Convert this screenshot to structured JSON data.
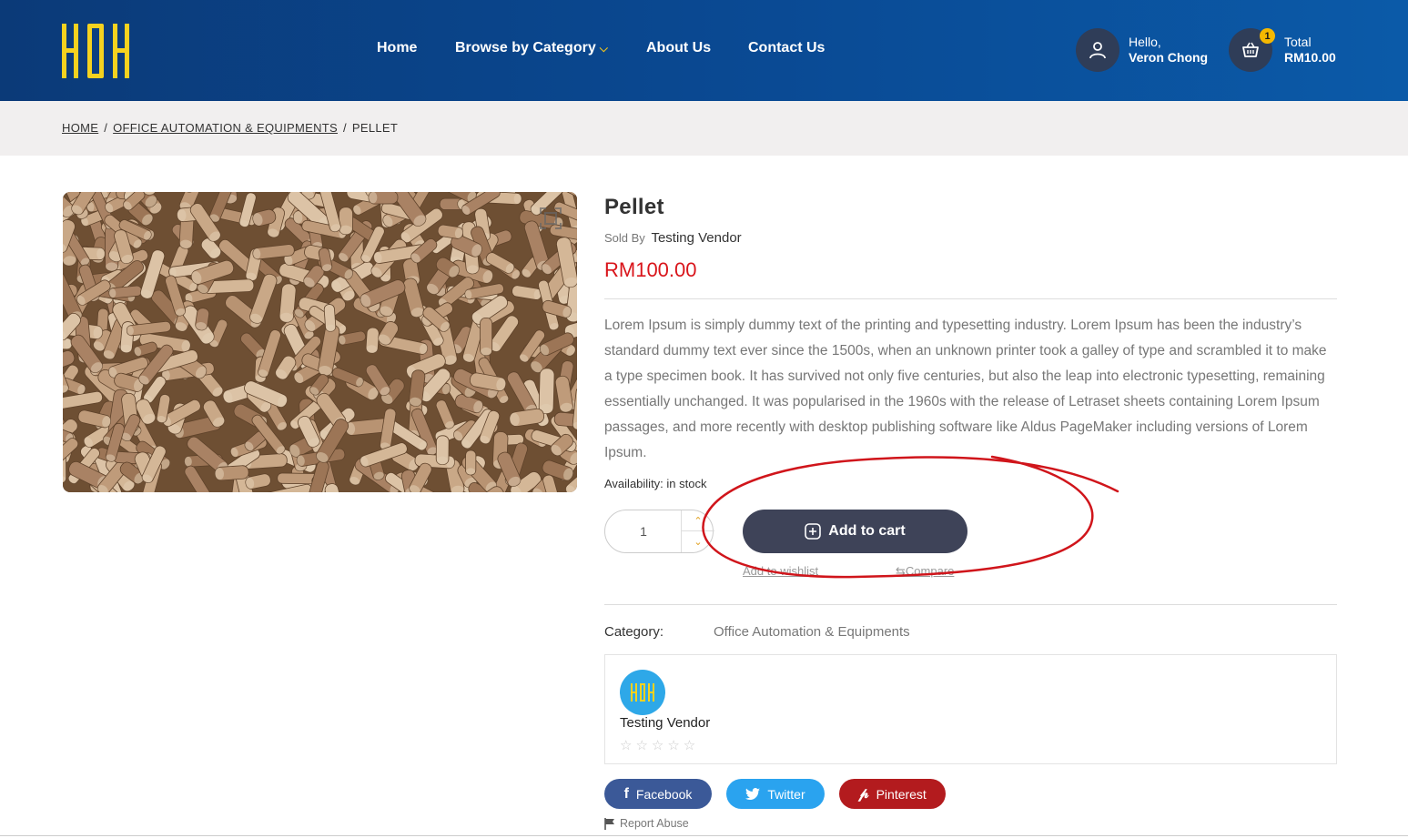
{
  "header": {
    "logo_text": "HOH",
    "nav": [
      {
        "label": "Home"
      },
      {
        "label": "Browse by Category"
      },
      {
        "label": "About Us"
      },
      {
        "label": "Contact Us"
      }
    ],
    "account": {
      "greeting": "Hello,",
      "name": "Veron Chong"
    },
    "cart": {
      "label": "Total",
      "amount": "RM10.00",
      "count": "1"
    }
  },
  "breadcrumb": {
    "home": "HOME",
    "category": "OFFICE AUTOMATION & EQUIPMENTS",
    "current": "PELLET",
    "separator": "/"
  },
  "product": {
    "title": "Pellet",
    "sold_by_label": "Sold By",
    "vendor": "Testing Vendor",
    "price": "RM100.00",
    "description": "Lorem Ipsum is simply dummy text of the printing and typesetting industry. Lorem Ipsum has been the industry’s standard dummy text ever since the 1500s, when an unknown printer took a galley of type and scrambled it to make a type specimen book. It has survived not only five centuries, but also the leap into electronic typesetting, remaining essentially unchanged. It was popularised in the 1960s with the release of Letraset sheets containing Lorem Ipsum passages, and more recently with desktop publishing software like Aldus PageMaker including versions of Lorem Ipsum.",
    "availability": "Availability: in stock",
    "quantity": "1",
    "add_to_cart": "Add to cart",
    "wishlist": "Add to wishlist",
    "compare": "Compare",
    "category_label": "Category:",
    "category_value": "Office Automation & Equipments"
  },
  "vendor_card": {
    "logo_text": "HOH",
    "name": "Testing Vendor",
    "rating": 0,
    "stars": "☆☆☆☆☆"
  },
  "share": {
    "facebook": "Facebook",
    "twitter": "Twitter",
    "pinterest": "Pinterest"
  },
  "report_abuse": "Report Abuse",
  "colors": {
    "header_bg": "#0a4a94",
    "logo": "#f5d21f",
    "price": "#d9151b",
    "cart_button": "#3e4358",
    "annotation": "#d0151b"
  }
}
